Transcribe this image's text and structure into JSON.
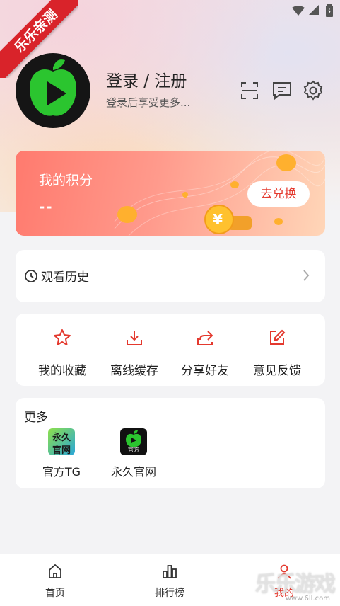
{
  "ribbon": {
    "text": "乐乐亲测"
  },
  "profile": {
    "title": "登录 / 注册",
    "subtitle": "登录后享受更多..."
  },
  "points": {
    "title": "我的积分",
    "value": "--",
    "redeem_label": "去兑换"
  },
  "history": {
    "label": "观看历史"
  },
  "actions": [
    {
      "label": "我的收藏",
      "icon": "star-icon"
    },
    {
      "label": "离线缓存",
      "icon": "download-icon"
    },
    {
      "label": "分享好友",
      "icon": "share-icon"
    },
    {
      "label": "意见反馈",
      "icon": "edit-icon"
    }
  ],
  "more": {
    "title": "更多",
    "items": [
      {
        "label": "官方TG",
        "icon_text_1": "永久",
        "icon_text_2": "官网"
      },
      {
        "label": "永久官网",
        "icon_caption": "官方"
      }
    ]
  },
  "tabs": [
    {
      "label": "首页",
      "icon": "home-icon"
    },
    {
      "label": "排行榜",
      "icon": "chart-icon"
    },
    {
      "label": "我的",
      "icon": "user-icon",
      "active": true
    }
  ],
  "watermark": {
    "text": "乐乐游戏",
    "url": "www.6ll.com"
  },
  "colors": {
    "accent": "#e4392e",
    "brand_green": "#2bc52f"
  }
}
